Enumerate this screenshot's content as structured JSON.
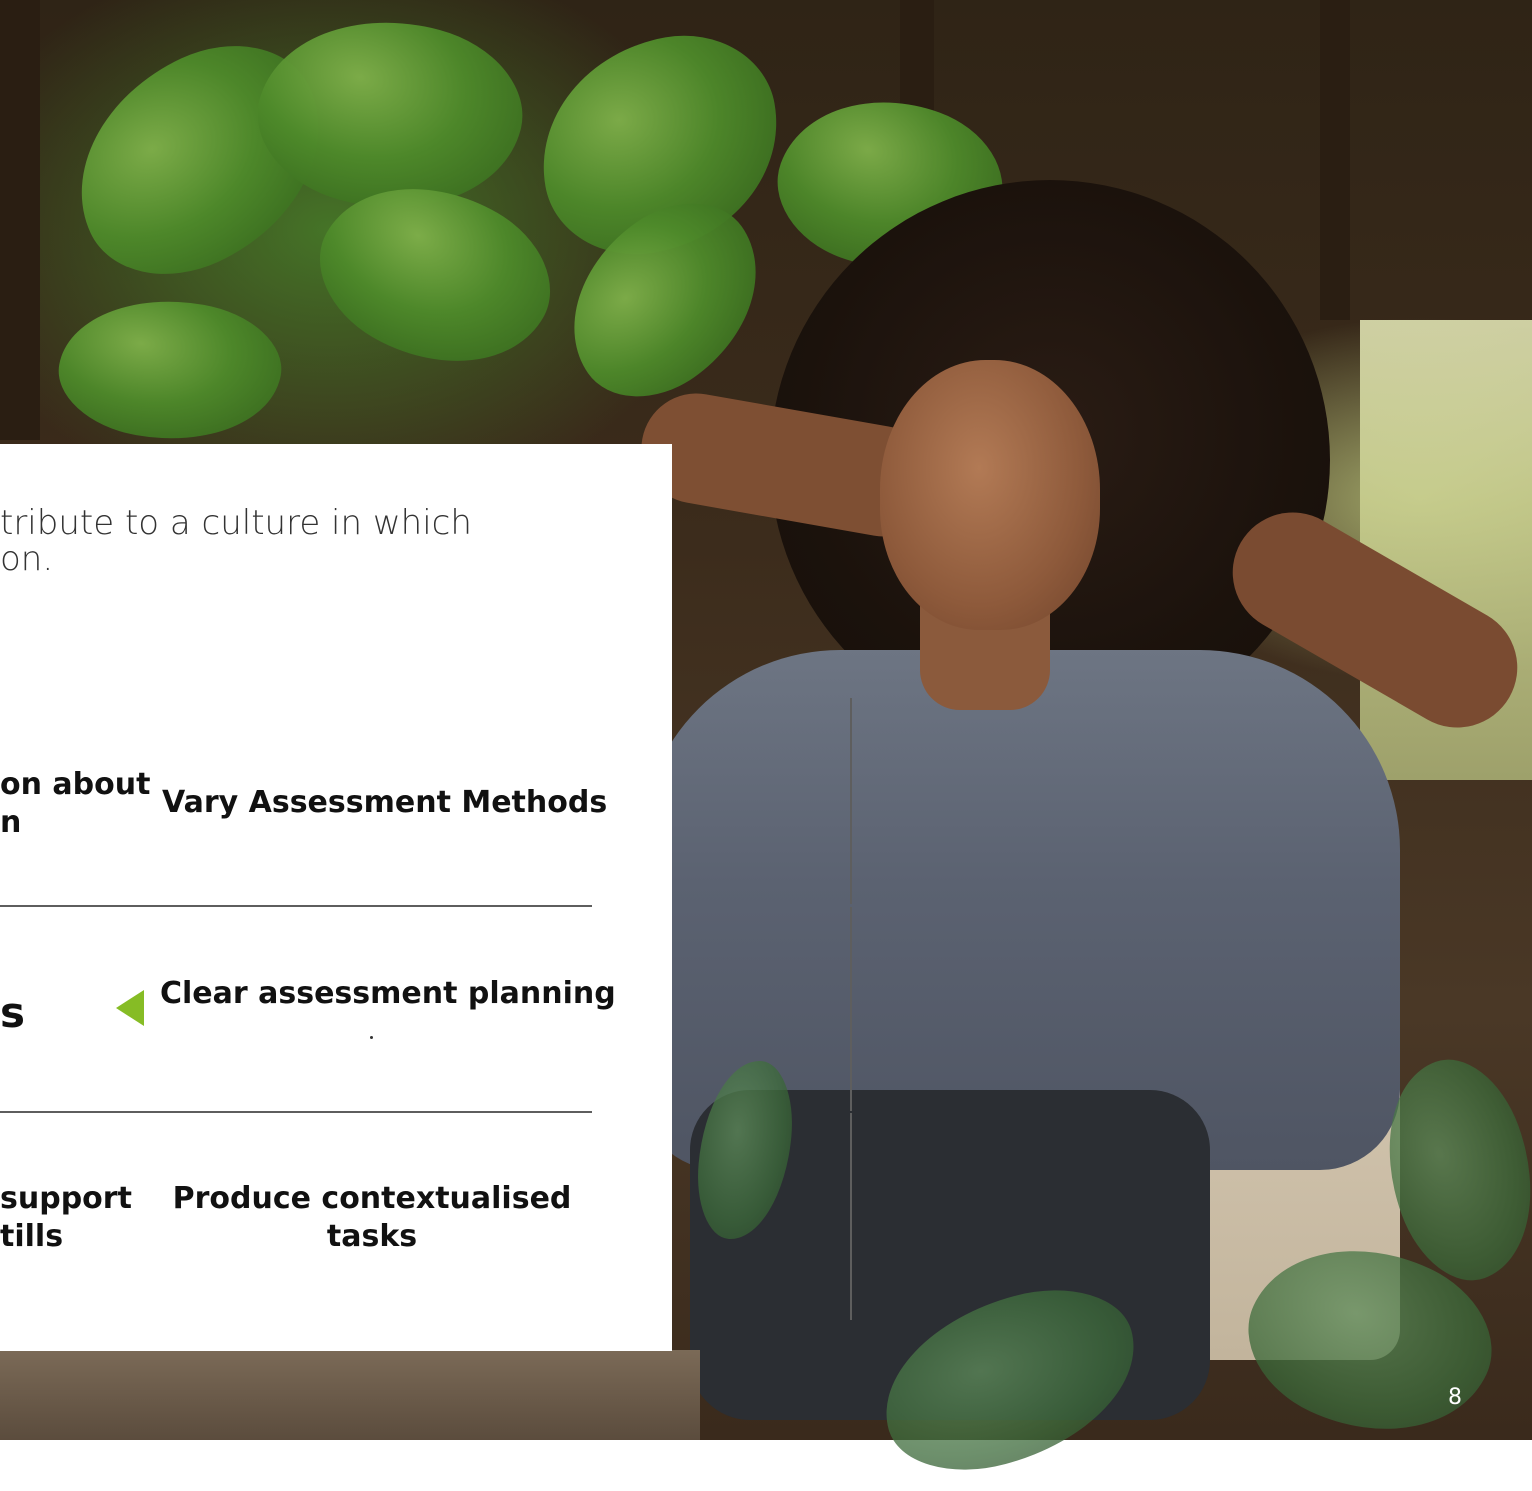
{
  "intro": {
    "line1": "tribute to a culture in which",
    "line2": "on."
  },
  "grid": {
    "row1": {
      "left_line1": "on about",
      "left_line2": "n",
      "right": "Vary Assessment Methods"
    },
    "row2": {
      "left": "s",
      "right": "Clear assessment planning"
    },
    "row3": {
      "left_line1": "support",
      "left_line2": "tills",
      "right_line1": "Produce contextualised",
      "right_line2": "tasks"
    }
  },
  "page_number": "8",
  "colors": {
    "accent": "#86bc25",
    "card": "#ffffff",
    "text": "#111111",
    "rule": "#5e5e5e"
  }
}
